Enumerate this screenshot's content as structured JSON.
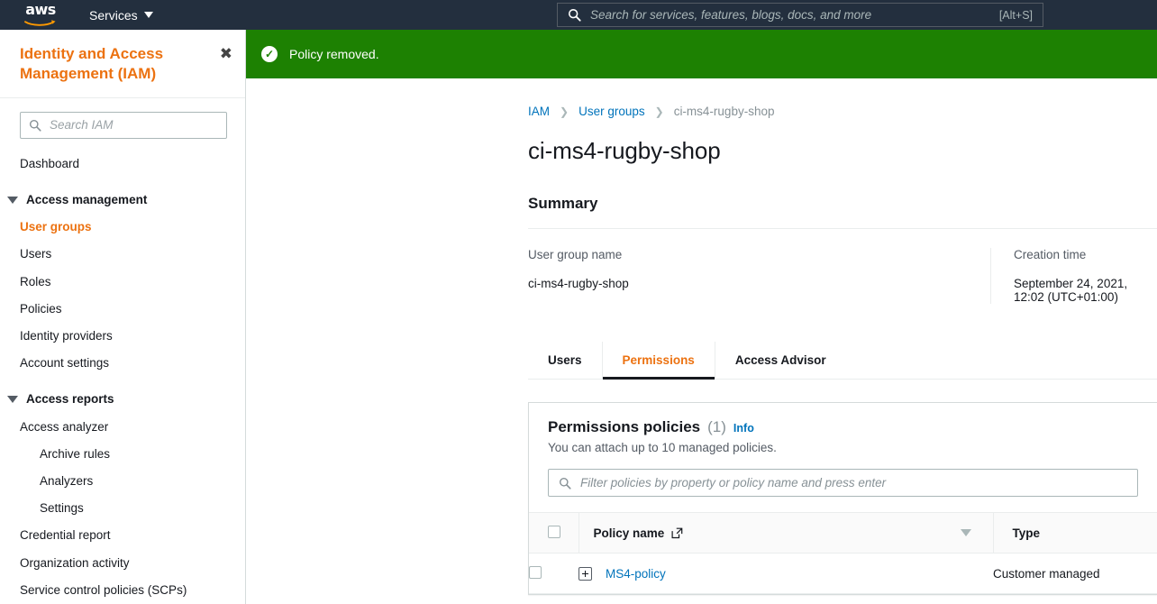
{
  "topnav": {
    "logo_text": "aws",
    "services_label": "Services",
    "search": {
      "placeholder": "Search for services, features, blogs, docs, and more",
      "shortcut": "[Alt+S]",
      "icon": "search-icon"
    }
  },
  "sidebar": {
    "title": "Identity and Access Management (IAM)",
    "close_icon": "close-icon",
    "search": {
      "placeholder": "Search IAM",
      "icon": "search-icon"
    },
    "items": [
      {
        "label": "Dashboard",
        "type": "link",
        "active": false
      },
      {
        "label": "Access management",
        "type": "group",
        "active": false
      },
      {
        "label": "User groups",
        "type": "link",
        "active": true
      },
      {
        "label": "Users",
        "type": "link",
        "active": false
      },
      {
        "label": "Roles",
        "type": "link",
        "active": false
      },
      {
        "label": "Policies",
        "type": "link",
        "active": false
      },
      {
        "label": "Identity providers",
        "type": "link",
        "active": false
      },
      {
        "label": "Account settings",
        "type": "link",
        "active": false
      },
      {
        "label": "Access reports",
        "type": "group",
        "active": false
      },
      {
        "label": "Access analyzer",
        "type": "link",
        "active": false
      },
      {
        "label": "Archive rules",
        "type": "sublink",
        "active": false
      },
      {
        "label": "Analyzers",
        "type": "sublink",
        "active": false
      },
      {
        "label": "Settings",
        "type": "sublink",
        "active": false
      },
      {
        "label": "Credential report",
        "type": "link",
        "active": false
      },
      {
        "label": "Organization activity",
        "type": "link",
        "active": false
      },
      {
        "label": "Service control policies (SCPs)",
        "type": "link",
        "active": false
      }
    ]
  },
  "flash": {
    "message": "Policy removed.",
    "icon": "check-circle-icon",
    "color": "#1d8102"
  },
  "breadcrumb": {
    "items": [
      {
        "label": "IAM",
        "link": true
      },
      {
        "label": "User groups",
        "link": true
      },
      {
        "label": "ci-ms4-rugby-shop",
        "link": false
      }
    ],
    "separator": "›"
  },
  "page": {
    "title": "ci-ms4-rugby-shop"
  },
  "summary": {
    "heading": "Summary",
    "fields": [
      {
        "label": "User group name",
        "value": "ci-ms4-rugby-shop"
      },
      {
        "label": "Creation time",
        "value": "September 24, 2021, 12:02 (UTC+01:00)"
      }
    ]
  },
  "tabs": [
    {
      "label": "Users",
      "active": false
    },
    {
      "label": "Permissions",
      "active": true
    },
    {
      "label": "Access Advisor",
      "active": false
    }
  ],
  "permissions_panel": {
    "title": "Permissions policies",
    "count": "(1)",
    "info_label": "Info",
    "subtitle": "You can attach up to 10 managed policies.",
    "filter": {
      "placeholder": "Filter policies by property or policy name and press enter",
      "icon": "search-icon"
    },
    "table": {
      "columns": [
        {
          "label": "Policy name",
          "icon": "external-link-icon"
        },
        {
          "label": "Type",
          "icon": "sort-descending-icon"
        }
      ],
      "rows": [
        {
          "checkbox": "unchecked",
          "expand_icon": "expand-plus-icon",
          "policy_name": "MS4-policy",
          "type": "Customer managed"
        }
      ]
    }
  },
  "colors": {
    "aws_navy": "#232f3e",
    "aws_orange": "#ec7211",
    "link_blue": "#0073bb",
    "success_green": "#1d8102"
  }
}
